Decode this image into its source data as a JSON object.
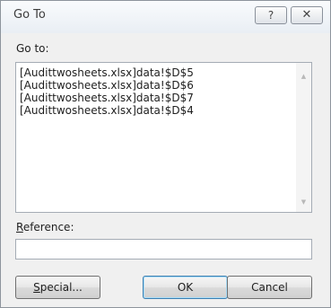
{
  "dialog": {
    "title": "Go To",
    "help_glyph": "?",
    "close_glyph": "✕"
  },
  "goto": {
    "label": "Go to:",
    "items": [
      "[Audittwosheets.xlsx]data!$D$5",
      "[Audittwosheets.xlsx]data!$D$6",
      "[Audittwosheets.xlsx]data!$D$7",
      "[Audittwosheets.xlsx]data!$D$4"
    ],
    "scroll_up_glyph": "▲",
    "scroll_down_glyph": "▼"
  },
  "reference": {
    "label_mnemonic": "R",
    "label_rest": "eference:",
    "value": ""
  },
  "buttons": {
    "special_mnemonic": "S",
    "special_rest": "pecial...",
    "ok": "OK",
    "cancel": "Cancel"
  }
}
